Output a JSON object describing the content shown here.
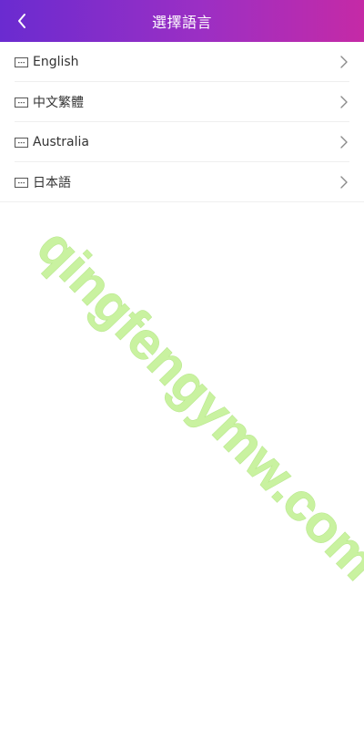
{
  "header": {
    "title": "選擇語言",
    "back_icon": "chevron-left-icon"
  },
  "languages": [
    {
      "label": "English",
      "icon": "message-icon"
    },
    {
      "label": "中文繁體",
      "icon": "message-icon"
    },
    {
      "label": "Australia",
      "icon": "message-icon"
    },
    {
      "label": "日本語",
      "icon": "message-icon"
    }
  ],
  "watermark": {
    "text": "qingfengymw.com",
    "color": "#c9f2a0"
  },
  "colors": {
    "header_start": "#6a2bd0",
    "header_end": "#c52aa6",
    "divider": "#efefef",
    "text": "#333333",
    "chevron": "#8a8a8a"
  }
}
